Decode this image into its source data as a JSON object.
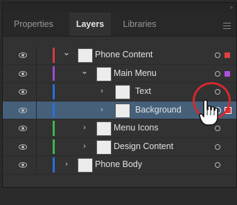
{
  "tabs": [
    {
      "label": "Properties",
      "active": false
    },
    {
      "label": "Layers",
      "active": true
    },
    {
      "label": "Libraries",
      "active": false
    }
  ],
  "layers": [
    {
      "name": "Phone Content",
      "level": 0,
      "color": "#d93b3b",
      "expanded": true,
      "selected": false,
      "sel_color": "#e24040"
    },
    {
      "name": "Main Menu",
      "level": 1,
      "color": "#a54ad0",
      "expanded": true,
      "selected": false,
      "sel_color": "#b04ee0"
    },
    {
      "name": "Text",
      "level": 2,
      "color": "#2a6fdc",
      "expanded": false,
      "selected": false,
      "sel_color": ""
    },
    {
      "name": "Background",
      "level": 2,
      "color": "#2a6fdc",
      "expanded": false,
      "selected": true,
      "sel_color": "#e23535"
    },
    {
      "name": "Menu Icons",
      "level": 1,
      "color": "#3fb84c",
      "expanded": false,
      "selected": false,
      "sel_color": ""
    },
    {
      "name": "Design Content",
      "level": 1,
      "color": "#3fb84c",
      "expanded": false,
      "selected": false,
      "sel_color": ""
    },
    {
      "name": "Phone Body",
      "level": 0,
      "color": "#2a6fdc",
      "expanded": false,
      "selected": false,
      "sel_color": ""
    }
  ]
}
